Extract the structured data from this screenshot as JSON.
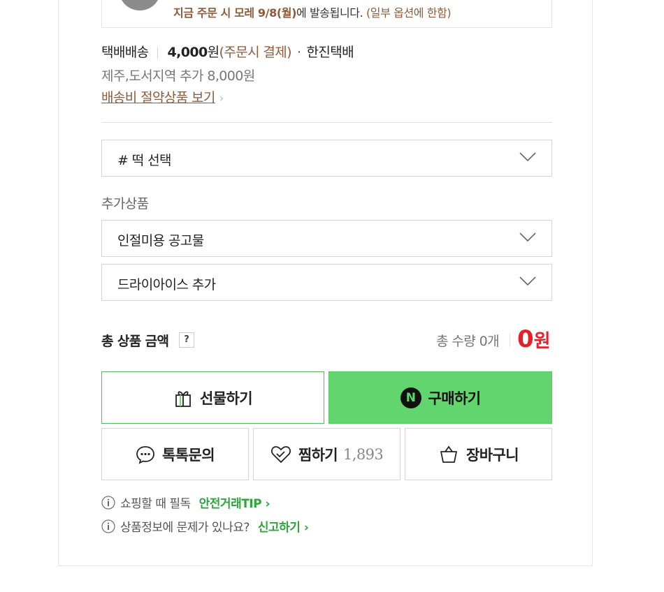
{
  "notice": {
    "bold_part": "지금 주문 시 모레 9/8(월)",
    "middle_part": "에 발송됩니다.",
    "note_part": "(일부 옵션에 한함)"
  },
  "shipping": {
    "method": "택배배송",
    "price": "4,000",
    "price_unit": "원",
    "payment": "(주문시 결제)",
    "dot": "·",
    "carrier": "한진택배",
    "extra": "제주,도서지역 추가 8,000원",
    "link": "배송비 절약상품 보기",
    "link_chevron": "›"
  },
  "option_select": {
    "label": "# 떡 선택"
  },
  "addons": {
    "title": "추가상품",
    "items": [
      {
        "label": "인절미용 공고물"
      },
      {
        "label": "드라이아이스 추가"
      }
    ]
  },
  "total": {
    "label": "총 상품 금액",
    "help": "?",
    "quantity": "총 수량 0개",
    "price": "0",
    "unit": "원"
  },
  "buttons": {
    "gift": "선물하기",
    "buy": "구매하기",
    "buy_badge": "N",
    "talk": "톡톡문의",
    "wish": "찜하기",
    "wish_count": "1,893",
    "cart": "장바구니"
  },
  "tips": [
    {
      "text": "쇼핑할 때 필독",
      "link": "안전거래TIP ›"
    },
    {
      "text": "상품정보에 문제가 있나요?",
      "link": "신고하기 ›"
    }
  ],
  "colors": {
    "accent_green": "#63d56e",
    "link_green": "#2ea43b",
    "brown": "#8d5a3a",
    "price_red": "#e4202b"
  }
}
